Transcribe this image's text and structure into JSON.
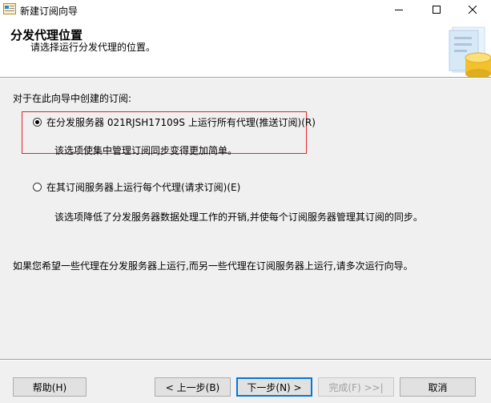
{
  "window": {
    "title": "新建订阅向导"
  },
  "header": {
    "title": "分发代理位置",
    "subtitle": "请选择运行分发代理的位置。"
  },
  "content": {
    "prompt": "对于在此向导中创建的订阅:",
    "options": [
      {
        "label": "在分发服务器 021RJSH17109S 上运行所有代理(推送订阅)(R)",
        "description": "该选项使集中管理订阅同步变得更加简单。",
        "checked": true
      },
      {
        "label": "在其订阅服务器上运行每个代理(请求订阅)(E)",
        "description": "该选项降低了分发服务器数据处理工作的开销,并使每个订阅服务器管理其订阅的同步。",
        "checked": false
      }
    ],
    "note": "如果您希望一些代理在分发服务器上运行,而另一些代理在订阅服务器上运行,请多次运行向导。"
  },
  "footer": {
    "help": "帮助(H)",
    "back": "< 上一步(B)",
    "next": "下一步(N) >",
    "finish": "完成(F) >>|",
    "cancel": "取消"
  },
  "colors": {
    "highlight_box": "#e8242c",
    "default_button_border": "#0078d7"
  },
  "icons": {
    "app": "wizard-app-icon",
    "minimize": "minimize-icon",
    "maximize": "maximize-icon",
    "close": "close-icon",
    "header_graphic": "database-document-graphic"
  }
}
